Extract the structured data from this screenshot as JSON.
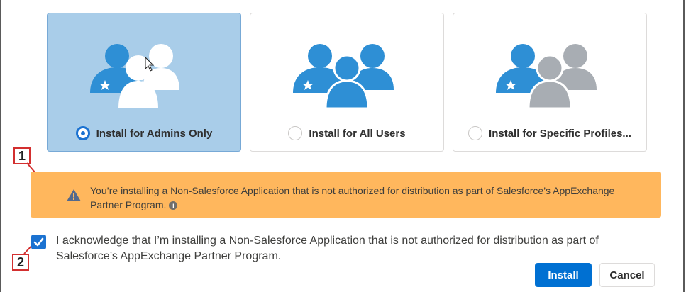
{
  "install_options": [
    {
      "label": "Install for Admins Only",
      "selected": true
    },
    {
      "label": "Install for All Users",
      "selected": false
    },
    {
      "label": "Install for Specific Profiles...",
      "selected": false
    }
  ],
  "callouts": {
    "first": "1",
    "second": "2"
  },
  "warning": {
    "text": "You’re installing a Non-Salesforce Application that is not authorized for distribution as part of Salesforce’s AppExchange Partner Program.",
    "info_glyph": "i"
  },
  "acknowledge": {
    "checked": true,
    "text": "I acknowledge that I’m installing a Non-Salesforce Application that is not authorized for distribution as part of Salesforce’s AppExchange Partner Program."
  },
  "buttons": {
    "install": "Install",
    "cancel": "Cancel"
  },
  "colors": {
    "brand_blue": "#0070d2",
    "selected_card": "#a9cde9",
    "warning_bg": "#ffb75d",
    "person_blue": "#2e8fd5",
    "person_gray": "#a8adb3",
    "callout_red": "#d32f2f"
  },
  "icons": [
    "users-icon",
    "star-icon",
    "warning-icon",
    "info-icon",
    "checkmark-icon",
    "mouse-cursor-icon"
  ]
}
